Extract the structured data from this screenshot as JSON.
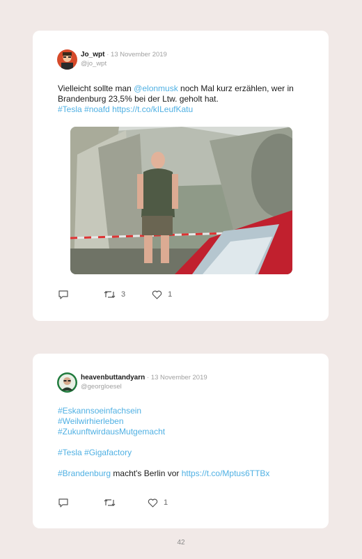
{
  "tweets": [
    {
      "name": "Jo_wpt",
      "date": "· 13 November 2019",
      "handle": "@jo_wpt",
      "text": {
        "t1": "Vielleicht sollte man ",
        "mention": "@elonmusk",
        "t2": " noch Mal kurz erzählen, wer in Brandenburg 23,5% bei der Ltw. geholt hat.",
        "hashtag1": "#Tesla",
        "hashtag2": "#noafd",
        "link": "https://t.co/kILeufKatu"
      },
      "retweets": "3",
      "likes": "1"
    },
    {
      "name": "heavenbuttandyarn",
      "date": "· 13 November 2019",
      "handle": "@georgloesel",
      "lines": {
        "h1": "#Eskannsoeinfachsein",
        "h2": "#Weilwirhierleben",
        "h3": "#ZukunftwirdausMutgemacht",
        "h4a": "#Tesla",
        "h4b": "#Gigafactory",
        "h5a": "#Brandenburg",
        "h5b": " macht's Berlin vor ",
        "h5c": "https://t.co/Mptus6TTBx"
      },
      "likes": "1"
    }
  ],
  "page_number": "42",
  "colors": {
    "link": "#4fb0e3",
    "background": "#f1e9e7",
    "card": "#ffffff"
  }
}
